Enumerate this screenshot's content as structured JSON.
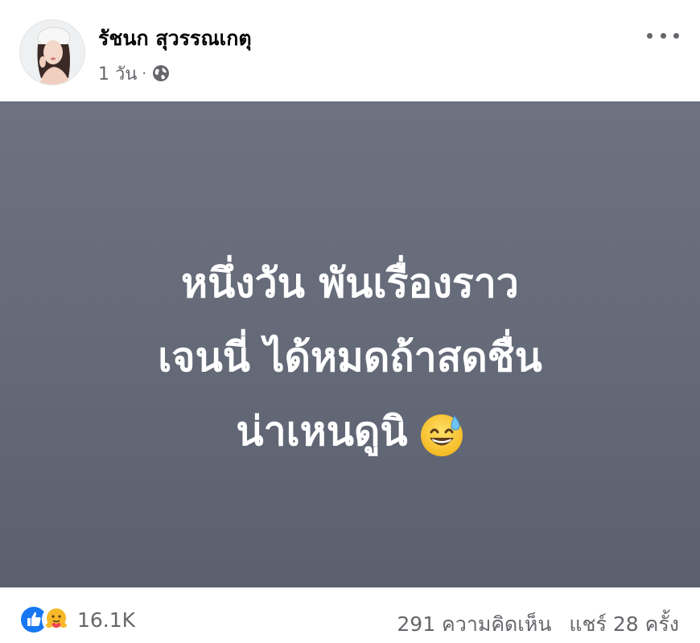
{
  "post": {
    "author": "รัชนก สุวรรณเกตุ",
    "time": "1 วัน",
    "separator": "·",
    "privacy_icon": "globe-icon",
    "more_icon": "more-options-icon",
    "text_lines": [
      "หนึ่งวัน พันเรื่องราว",
      "เจนนี่ ได้หมดถ้าสดชื่น",
      "น่าเหนดูนิ"
    ],
    "emoji": "grinning-face-with-sweat",
    "background_colors": [
      "#6d7280",
      "#5b606f"
    ]
  },
  "footer": {
    "reaction_icons": [
      "like-icon",
      "care-icon"
    ],
    "reaction_count": "16.1K",
    "comments": "291 ความคิดเห็น",
    "shares": "แชร์ 28 ครั้ง"
  },
  "colors": {
    "like_blue": "#1877f2",
    "care_yellow": "#f7b928",
    "secondary_text": "#65676b"
  }
}
